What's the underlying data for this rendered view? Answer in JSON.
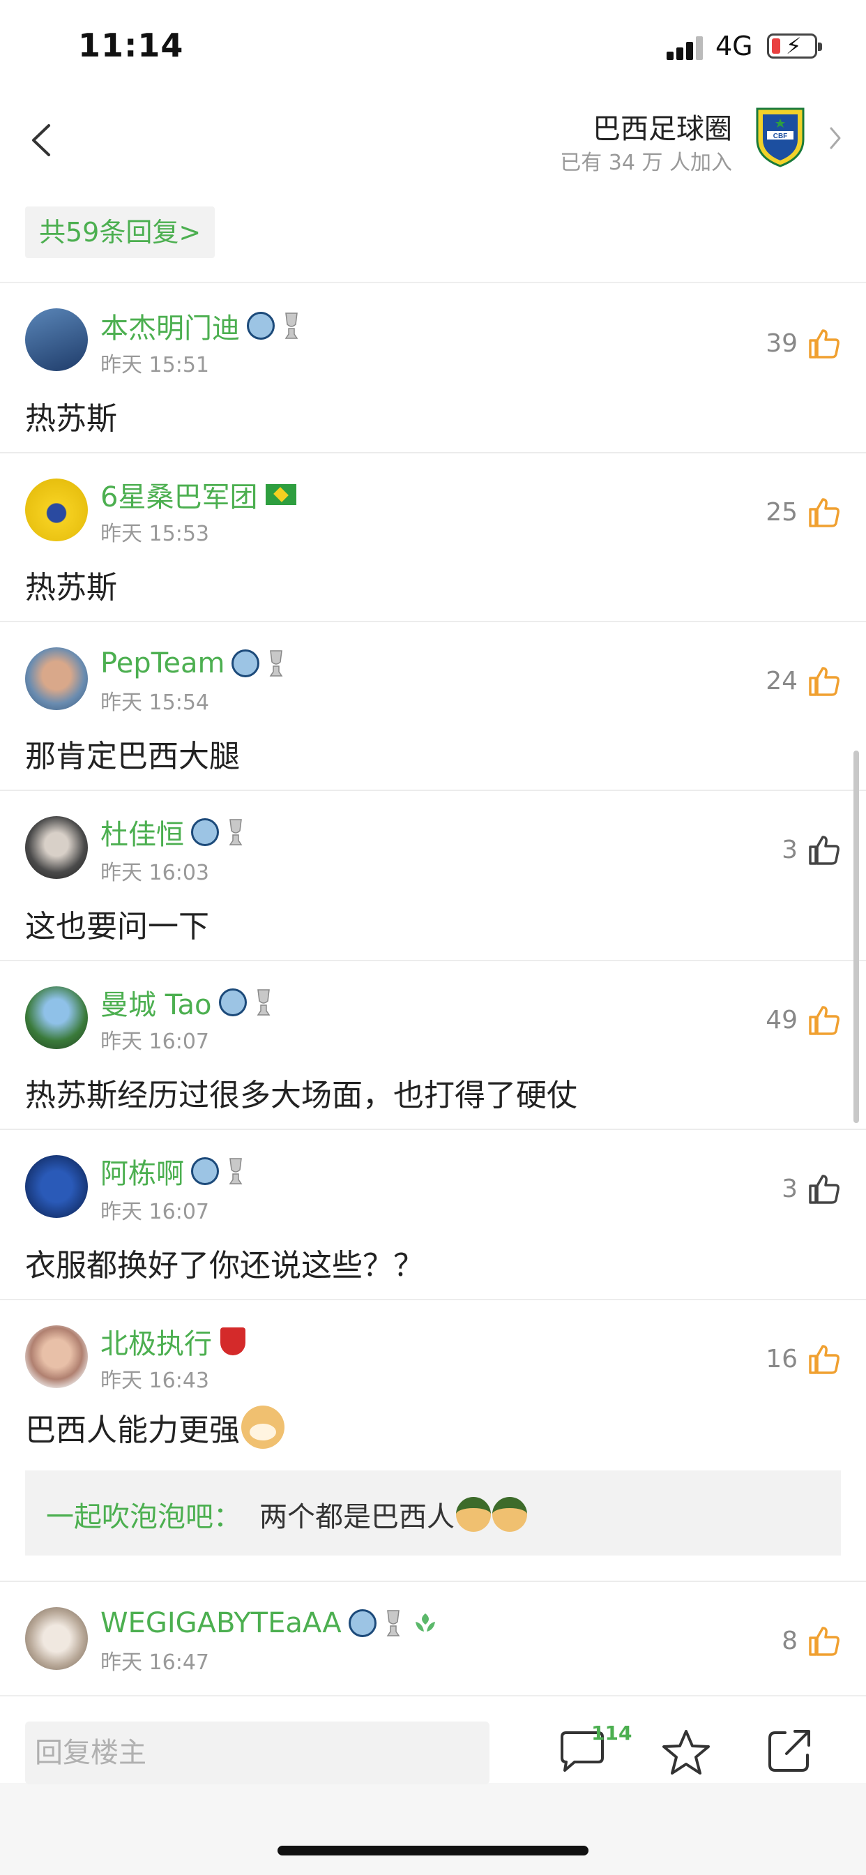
{
  "status": {
    "time": "11:14",
    "network": "4G"
  },
  "header": {
    "circle_name": "巴西足球圈",
    "members": "已有 34 万 人加入",
    "logo_text": "CBF"
  },
  "reply_count": "共59条回复>",
  "comments": [
    {
      "user": "本杰明门迪",
      "time": "昨天 15:51",
      "content": "热苏斯",
      "likes": "39",
      "liked": true,
      "badges": [
        "mancity-badge",
        "trophy"
      ]
    },
    {
      "user": "6星桑巴军团",
      "time": "昨天 15:53",
      "content": "热苏斯",
      "likes": "25",
      "liked": true,
      "badges": [
        "brazil-flag"
      ]
    },
    {
      "user": "PepTeam",
      "time": "昨天 15:54",
      "content": "那肯定巴西大腿",
      "likes": "24",
      "liked": true,
      "badges": [
        "mancity-badge",
        "trophy"
      ]
    },
    {
      "user": "杜佳恒",
      "time": "昨天 16:03",
      "content": "这也要问一下",
      "likes": "3",
      "liked": false,
      "badges": [
        "mancity-badge",
        "trophy"
      ]
    },
    {
      "user": "曼城 Tao",
      "time": "昨天 16:07",
      "content": "热苏斯经历过很多大场面，也打得了硬仗",
      "likes": "49",
      "liked": true,
      "badges": [
        "mancity-badge",
        "trophy"
      ]
    },
    {
      "user": "阿栋啊",
      "time": "昨天 16:07",
      "content": "衣服都换好了你还说这些？？",
      "likes": "3",
      "liked": false,
      "badges": [
        "mancity-badge",
        "trophy"
      ]
    },
    {
      "user": "北极执行",
      "time": "昨天 16:43",
      "content": "巴西人能力更强",
      "likes": "16",
      "liked": true,
      "badges": [
        "arsenal-badge"
      ],
      "sub_reply": {
        "user": "一起吹泡泡吧：",
        "text": "两个都是巴西人"
      }
    },
    {
      "user": "WEGIGABYTEaAA",
      "time": "昨天 16:47",
      "content": "",
      "likes": "8",
      "liked": true,
      "badges": [
        "mancity-badge",
        "trophy",
        "leaf-badge"
      ]
    }
  ],
  "bottom": {
    "reply_placeholder": "回复楼主",
    "comment_count": "114"
  },
  "colors": {
    "accent": "#4caf50",
    "like": "#f0a030",
    "muted": "#999999"
  }
}
